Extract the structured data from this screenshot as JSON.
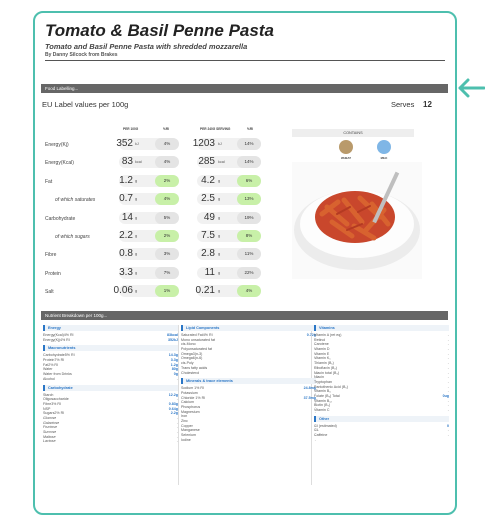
{
  "title": "Tomato & Basil Penne Pasta",
  "subtitle": "Tomato and Basil Penne Pasta with shredded mozzarella",
  "byline": "By Danny Silcock from Brakes",
  "food_labelling_bar": "Food Labelling...",
  "eu_label": "EU Label values per 100g",
  "serves_label": "Serves",
  "serves_value": "12",
  "col_headers": {
    "per100": "PER 100G",
    "gda1": "%RI",
    "perserving": "PER 240G SERVING",
    "gda2": "%RI"
  },
  "nutrients": [
    {
      "label": "Energy(Kj)",
      "indent": false,
      "v1": "352",
      "u1": "kJ",
      "p1": "4%",
      "v2": "1203",
      "u2": "kJ",
      "p2": "14%",
      "c1": "#e4e4e4",
      "c2": "#e4e4e4"
    },
    {
      "label": "Energy(Kcal)",
      "indent": false,
      "v1": "83",
      "u1": "kcal",
      "p1": "4%",
      "v2": "285",
      "u2": "kcal",
      "p2": "14%",
      "c1": "#e4e4e4",
      "c2": "#e4e4e4"
    },
    {
      "label": "Fat",
      "indent": false,
      "v1": "1.2",
      "u1": "g",
      "p1": "2%",
      "v2": "4.2",
      "u2": "g",
      "p2": "6%",
      "c1": "#c8f0a8",
      "c2": "#c8f0a8"
    },
    {
      "label": "of which saturates",
      "indent": true,
      "v1": "0.7",
      "u1": "g",
      "p1": "4%",
      "v2": "2.5",
      "u2": "g",
      "p2": "13%",
      "c1": "#c8f0a8",
      "c2": "#c8f0a8"
    },
    {
      "label": "Carbohydrate",
      "indent": false,
      "v1": "14",
      "u1": "g",
      "p1": "5%",
      "v2": "49",
      "u2": "g",
      "p2": "19%",
      "c1": "#e4e4e4",
      "c2": "#e4e4e4"
    },
    {
      "label": "of which sugars",
      "indent": true,
      "v1": "2.2",
      "u1": "g",
      "p1": "2%",
      "v2": "7.5",
      "u2": "g",
      "p2": "8%",
      "c1": "#c8f0a8",
      "c2": "#c8f0a8"
    },
    {
      "label": "Fibre",
      "indent": false,
      "v1": "0.8",
      "u1": "g",
      "p1": "3%",
      "v2": "2.8",
      "u2": "g",
      "p2": "11%",
      "c1": "#e4e4e4",
      "c2": "#e4e4e4"
    },
    {
      "label": "Protein",
      "indent": false,
      "v1": "3.3",
      "u1": "g",
      "p1": "7%",
      "v2": "11",
      "u2": "g",
      "p2": "22%",
      "c1": "#e4e4e4",
      "c2": "#e4e4e4"
    },
    {
      "label": "Salt",
      "indent": false,
      "v1": "0.06",
      "u1": "g",
      "p1": "1%",
      "v2": "0.21",
      "u2": "g",
      "p2": "4%",
      "c1": "#c8f0a8",
      "c2": "#c8f0a8"
    }
  ],
  "contains": {
    "label": "CONTAINS",
    "items": [
      {
        "name": "WHEAT",
        "color": "#b99a6b"
      },
      {
        "name": "MILK",
        "color": "#7fb6e6"
      }
    ]
  },
  "breakdown_bar": "Nutrient Breakdown per 100g...",
  "columns": [
    [
      {
        "heading": "Energy",
        "rows": [
          {
            "l": "Energy(Kcal)4% RI",
            "v": "83kcal"
          },
          {
            "l": "Energy(Kj)4% RI",
            "v": "352kJ"
          }
        ]
      },
      {
        "heading": "Macronutrients",
        "rows": [
          {
            "l": "Carbohydrate5% RI",
            "v": "14.3g"
          },
          {
            "l": "Protein7% RI",
            "v": "3.3g"
          },
          {
            "l": "Fat2% RI",
            "v": "1.2g"
          },
          {
            "l": "Water",
            "v": "80g"
          },
          {
            "l": "Water from Drinks",
            "v": "0g"
          },
          {
            "l": "Alcohol",
            "v": "-"
          }
        ]
      },
      {
        "heading": "Carbohydrate",
        "rows": [
          {
            "l": "Starch",
            "v": "12.2g"
          },
          {
            "l": "Oligosaccharide",
            "v": "-"
          },
          {
            "l": "Fibre3% RI",
            "v": "0.83g"
          },
          {
            "l": "NSP",
            "v": "0.64g"
          },
          {
            "l": "Sugars2% RI",
            "v": "2.2g"
          },
          {
            "l": "Glucose",
            "v": "-",
            "i": true
          },
          {
            "l": "Galactose",
            "v": "-",
            "i": true
          },
          {
            "l": "Fructose",
            "v": "-",
            "i": true
          },
          {
            "l": "Sucrose",
            "v": "-",
            "i": true
          },
          {
            "l": "Maltose",
            "v": "-",
            "i": true
          },
          {
            "l": "Lactose",
            "v": "-",
            "i": true
          }
        ]
      }
    ],
    [
      {
        "heading": "Lipid Components",
        "rows": [
          {
            "l": "Saturated Fat4% RI",
            "v": "0.72g"
          },
          {
            "l": "Mono unsaturated fat",
            "v": "-"
          },
          {
            "l": "cis-Mono",
            "v": "-"
          },
          {
            "l": "Polyunsaturated fat",
            "v": "-"
          },
          {
            "l": "Omega3(n-3)",
            "v": "-"
          },
          {
            "l": "Omega6(n-6)",
            "v": "-"
          },
          {
            "l": "cis-Poly",
            "v": "-"
          },
          {
            "l": "Trans fatty acids",
            "v": "-"
          },
          {
            "l": "Cholesterol",
            "v": "-"
          }
        ]
      },
      {
        "heading": "Minerals & trace elements",
        "rows": [
          {
            "l": "Sodium 1% RI",
            "v": "24.8mg"
          },
          {
            "l": "Potassium",
            "v": "-"
          },
          {
            "l": "Chloride 1% RI",
            "v": "37.5mg"
          },
          {
            "l": "Calcium",
            "v": "-"
          },
          {
            "l": "Phosphorus",
            "v": "-"
          },
          {
            "l": "Magnesium",
            "v": "-"
          },
          {
            "l": "Iron",
            "v": "-"
          },
          {
            "l": "Zinc",
            "v": "-"
          },
          {
            "l": "Copper",
            "v": "-"
          },
          {
            "l": "Manganese",
            "v": "-"
          },
          {
            "l": "Selenium",
            "v": "-"
          },
          {
            "l": "Iodine",
            "v": "-"
          }
        ]
      }
    ],
    [
      {
        "heading": "Vitamins",
        "rows": [
          {
            "l": "Vitamin A (ret eq)",
            "v": "-"
          },
          {
            "l": "Retinol",
            "v": "-"
          },
          {
            "l": "Carotene",
            "v": "-"
          },
          {
            "l": "Vitamin D",
            "v": "-"
          },
          {
            "l": "Vitamin E",
            "v": "-"
          },
          {
            "l": "Vitamin K₁",
            "v": "-"
          },
          {
            "l": "Thiamin (B₁)",
            "v": "-"
          },
          {
            "l": "Riboflavin (B₂)",
            "v": "-"
          },
          {
            "l": "Niacin total (B₃)",
            "v": "-"
          },
          {
            "l": "Niacin",
            "v": "-"
          },
          {
            "l": "Tryptophan",
            "v": "-"
          },
          {
            "l": "Pantothenic Acid (B₅)",
            "v": "-"
          },
          {
            "l": "Vitamin B₆",
            "v": "-"
          },
          {
            "l": "Folate (B₉) Total",
            "v": "0ug"
          },
          {
            "l": "Vitamin B₁₂",
            "v": "-"
          },
          {
            "l": "Biotin (B₇)",
            "v": "-"
          },
          {
            "l": "Vitamin C",
            "v": "-"
          }
        ]
      },
      {
        "heading": "Other",
        "rows": [
          {
            "l": "GI (estimated)",
            "v": "0"
          },
          {
            "l": "GL",
            "v": "-"
          },
          {
            "l": "Caffeine",
            "v": "-"
          }
        ]
      }
    ]
  ]
}
